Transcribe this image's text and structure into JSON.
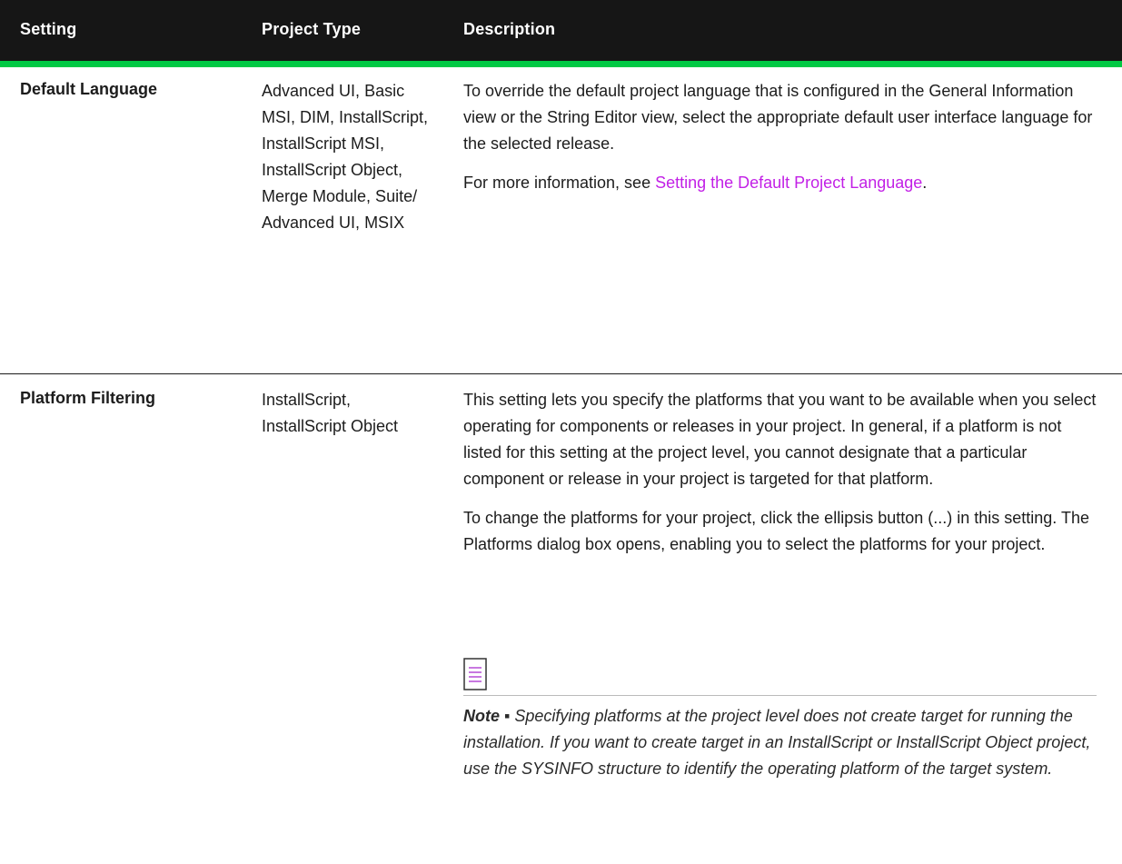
{
  "header": {
    "setting": "Setting",
    "project_type": "Project Type",
    "description": "Description"
  },
  "rows": [
    {
      "setting": "Default Language",
      "project_type": "Advanced UI, Basic MSI, DIM, InstallScript, InstallScript MSI, InstallScript Object, Merge Module, Suite/ Advanced UI, MSIX",
      "description_p1": "To override the default project language that is configured in the General Information view or the String Editor view, select the appropriate default user interface language for the selected release.",
      "description_p2_prefix": "For more information, see ",
      "description_p2_link": "Setting the Default Project Language",
      "description_p2_suffix": "."
    },
    {
      "setting": "Platform Filtering",
      "project_type": "InstallScript, InstallScript Object",
      "description_p1": "This setting lets you specify the platforms that you want to be available when you select operating  for components or releases in your project. In general, if a platform is not listed for this setting at the project level, you cannot designate that a particular component or release in your project is targeted for that platform.",
      "description_p2": "To change the platforms for your project, click the ellipsis button (...) in this setting. The Platforms dialog box opens, enabling you to select the platforms for your project.",
      "note_label": "Note ▪",
      "note_text": " Specifying platforms at the project level does not create target  for running the installation. If you want to create target  in an InstallScript or InstallScript Object project, use the SYSINFO structure to identify the operating platform of the target system.",
      "note_icon": "note-icon"
    }
  ],
  "colors": {
    "header_bg": "#161616",
    "header_rule": "#00c944",
    "link": "#c220e6"
  }
}
